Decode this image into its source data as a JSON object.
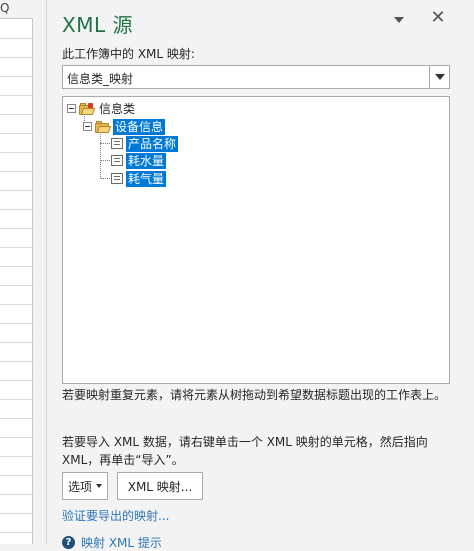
{
  "sheet": {
    "column_header": "Q"
  },
  "pane": {
    "title": "XML 源",
    "close_glyph": "✕",
    "maps_label": "此工作簿中的 XML 映射:",
    "map_selected": "信息类_映射",
    "tree": {
      "root": "信息类",
      "group": "设备信息",
      "children": [
        "产品名称",
        "耗水量",
        "耗气量"
      ]
    },
    "hint_repeat": "若要映射重复元素，请将元素从树拖动到希望数据标题出现的工作表上。",
    "hint_import": "若要导入 XML 数据，请右键单击一个 XML 映射的单元格，然后指向 XML，再单击“导入”。",
    "options_button": "选项",
    "xml_maps_button": "XML 映射...",
    "verify_link": "验证要导出的映射...",
    "tips_link": "映射 XML 提示"
  },
  "colors": {
    "accent": "#217346",
    "selection": "#0078d7",
    "link": "#2e75b6"
  },
  "icons": [
    "chevron-down-icon",
    "close-icon",
    "folder-icon",
    "element-icon",
    "help-icon"
  ]
}
